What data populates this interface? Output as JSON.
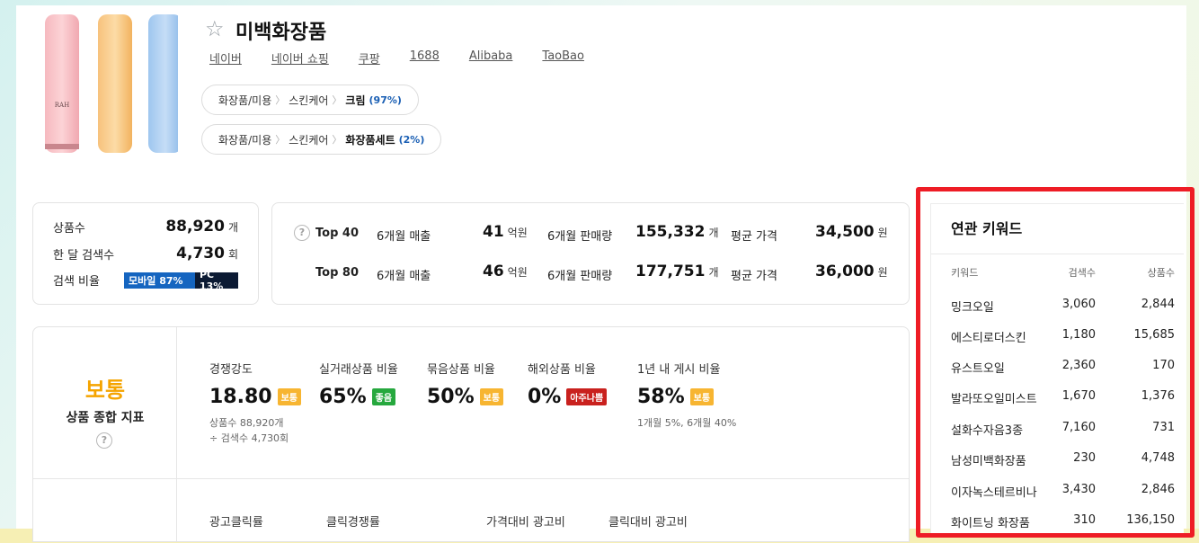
{
  "product": {
    "title": "미백화장품"
  },
  "links": [
    "네이버",
    "네이버 쇼핑",
    "쿠팡",
    "1688",
    "Alibaba",
    "TaoBao"
  ],
  "categories": [
    {
      "path1": "화장품/미용",
      "path2": "스킨케어",
      "leaf": "크림",
      "pct": "(97%)"
    },
    {
      "path1": "화장품/미용",
      "path2": "스킨케어",
      "leaf": "화장품세트",
      "pct": "(2%)"
    }
  ],
  "stats": {
    "product_count_label": "상품수",
    "product_count": "88,920",
    "product_count_unit": "개",
    "monthly_search_label": "한 달 검색수",
    "monthly_search": "4,730",
    "monthly_search_unit": "회",
    "ratio_label": "검색 비율",
    "mobile": "모바일 87%",
    "pc": "PC 13%",
    "mobile_share": 0.87
  },
  "top": [
    {
      "rank": "Top 40",
      "sales_label": "6개월 매출",
      "sales": "41",
      "sales_unit": "억원",
      "volume_label": "6개월 판매량",
      "volume": "155,332",
      "volume_unit": "개",
      "price_label": "평균 가격",
      "price": "34,500",
      "price_unit": "원"
    },
    {
      "rank": "Top 80",
      "sales_label": "6개월 매출",
      "sales": "46",
      "sales_unit": "억원",
      "volume_label": "6개월 판매량",
      "volume": "177,751",
      "volume_unit": "개",
      "price_label": "평균 가격",
      "price": "36,000",
      "price_unit": "원"
    }
  ],
  "summary": {
    "grade": "보통",
    "grade_label": "상품 종합 지표",
    "metrics": [
      {
        "label": "경쟁강도",
        "value": "18.80",
        "badge": "보통",
        "note1": "상품수 88,920개",
        "note2": "÷ 검색수 4,730회"
      },
      {
        "label": "실거래상품 비율",
        "value": "65%",
        "badge": "좋음"
      },
      {
        "label": "묶음상품 비율",
        "value": "50%",
        "badge": "보통"
      },
      {
        "label": "해외상품 비율",
        "value": "0%",
        "badge": "아주나쁨"
      },
      {
        "label": "1년 내 게시 비율",
        "value": "58%",
        "badge": "보통",
        "note1": "1개월 5%, 6개월 40%"
      }
    ],
    "ad_labels": [
      "광고클릭률",
      "클릭경쟁률",
      "가격대비 광고비",
      "클릭대비 광고비"
    ]
  },
  "keywords": {
    "title": "연관 키워드",
    "headers": [
      "키워드",
      "검색수",
      "상품수"
    ],
    "rows": [
      [
        "밍크오일",
        "3,060",
        "2,844"
      ],
      [
        "에스티로더스킨",
        "1,180",
        "15,685"
      ],
      [
        "유스트오일",
        "2,360",
        "170"
      ],
      [
        "발라또오일미스트",
        "1,670",
        "1,376"
      ],
      [
        "설화수자음3종",
        "7,160",
        "731"
      ],
      [
        "남성미백화장품",
        "230",
        "4,748"
      ],
      [
        "이자녹스테르비나",
        "3,430",
        "2,846"
      ],
      [
        "화이트닝 화장품",
        "310",
        "136,150"
      ]
    ]
  },
  "colors": {
    "grade": "#f5a400",
    "highlight_box": "#ee1c25",
    "mobile": "#1565c0",
    "pc": "#0b1a33",
    "badge_good": "#26a83e",
    "badge_normal": "#f7b531",
    "badge_bad": "#c9211e"
  }
}
